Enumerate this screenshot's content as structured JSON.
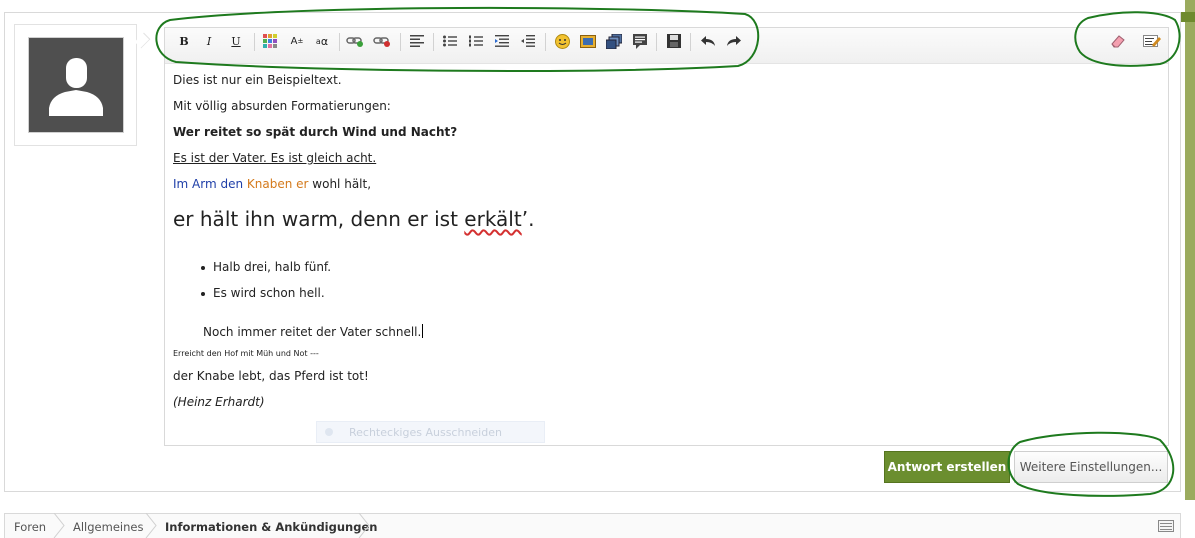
{
  "toolbar": {
    "bold": "B",
    "italic": "I",
    "underline": "U",
    "font_size": "A",
    "subscript": "a",
    "subscript_alt": "α"
  },
  "editor": {
    "lines": {
      "l1": "Dies ist nur ein Beispieltext.",
      "l2": "Mit völlig absurden Formatierungen:",
      "l3": "Wer reitet so spät durch Wind und Nacht?",
      "l4": "Es ist der Vater. Es ist gleich acht.",
      "l5a": "Im Arm den ",
      "l5b": "Knaben er",
      "l5c": " wohl hält,",
      "l6a": "er hält ihn warm, denn er ist ",
      "l6b": "erkält",
      "l6c": "’.",
      "b1": "Halb drei, halb fünf.",
      "b2": "Es wird schon hell.",
      "l7": "Noch immer reitet der Vater schnell.",
      "l8": "Erreicht den Hof mit Müh und Not ---",
      "l9": "der Knabe lebt, das Pferd ist tot!",
      "l10": "(Heinz Erhardt)"
    },
    "ghost_label": "Rechteckiges Ausschneiden"
  },
  "actions": {
    "submit": "Antwort erstellen",
    "more": "Weitere Einstellungen..."
  },
  "breadcrumb": {
    "items": [
      "Foren",
      "Allgemeines",
      "Informationen & Ankündigungen"
    ]
  },
  "colors": {
    "accent_green": "#6b8e2f",
    "annotation_green": "#1e7a1e",
    "text_blue": "#1f3fa8",
    "text_orange": "#d47a1c"
  }
}
